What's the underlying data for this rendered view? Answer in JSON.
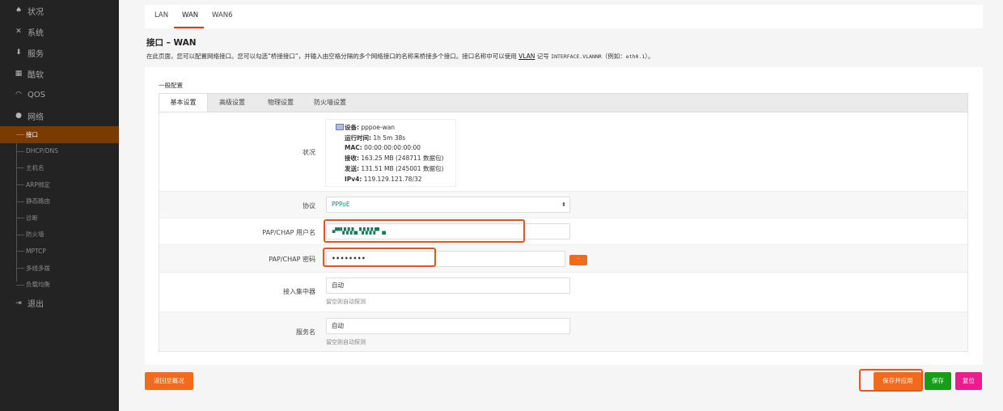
{
  "sidebar": {
    "items": [
      {
        "icon": "home-icon",
        "glyph": "♠",
        "label": "状况"
      },
      {
        "icon": "tools-icon",
        "glyph": "✕",
        "label": "系统"
      },
      {
        "icon": "download-icon",
        "glyph": "⬇",
        "label": "服务"
      },
      {
        "icon": "calendar-icon",
        "glyph": "▦",
        "label": "酷软"
      },
      {
        "icon": "gauge-icon",
        "glyph": "◠",
        "label": "QOS"
      },
      {
        "icon": "globe-icon",
        "glyph": "●",
        "label": "网络"
      }
    ],
    "sub_items": [
      "接口",
      "DHCP/DNS",
      "主机名",
      "ARP绑定",
      "静态路由",
      "诊断",
      "防火墙",
      "MPTCP",
      "多线多拨",
      "负载均衡"
    ],
    "logout": {
      "icon": "logout-icon",
      "glyph": "⇥",
      "label": "退出"
    }
  },
  "top_tabs": [
    "LAN",
    "WAN",
    "WAN6"
  ],
  "page": {
    "title": "接口 – WAN",
    "desc_pre": "在此页面，您可以配置网络接口。您可以勾选“桥接接口”，并输入由空格分隔的多个网络接口的名称来桥接多个接口。接口名称中可以使用 ",
    "desc_link": "VLAN",
    "desc_mid": " 记号 ",
    "desc_code": "INTERFACE.VLANNR",
    "desc_mid2": "（例如：",
    "desc_code2": "eth0.1",
    "desc_post": "）。"
  },
  "section": {
    "label": "一般配置",
    "tabs": [
      "基本设置",
      "高级设置",
      "物理设置",
      "防火墙设置"
    ]
  },
  "status": {
    "label": "状况",
    "device_key": "设备:",
    "device_val": "pppoe-wan",
    "uptime_key": "运行时间:",
    "uptime_val": "1h 5m 38s",
    "mac_key": "MAC:",
    "mac_val": "00:00:00:00:00:00",
    "rx_key": "接收:",
    "rx_val": "163.25 MB (248711 数据包)",
    "tx_key": "发送:",
    "tx_val": "131.51 MB (245001 数据包)",
    "ipv4_key": "IPv4:",
    "ipv4_val": "119.129.121.78/32"
  },
  "form": {
    "protocol_label": "协议",
    "protocol_value": "PPPoE",
    "username_label": "PAP/CHAP 用户名",
    "username_value": "▪▀ ▚▚▚▚▖▚▚▚▚▀ ▗▖",
    "password_label": "PAP/CHAP 密码",
    "password_value": "••••••••",
    "password_toggle": "⁻",
    "ac_label": "接入集中器",
    "ac_placeholder": "自动",
    "ac_hint": "留空则自动探测",
    "service_label": "服务名",
    "service_placeholder": "自动",
    "service_hint": "留空则自动探测"
  },
  "buttons": {
    "back": "返回至概况",
    "save_apply": "保存并应用",
    "save": "保存",
    "reset": "复位"
  },
  "colors": {
    "accent": "#f26b1d",
    "highlight": "#e9541b",
    "sidebar_bg": "#232323",
    "active_bg": "#7a3b02"
  }
}
